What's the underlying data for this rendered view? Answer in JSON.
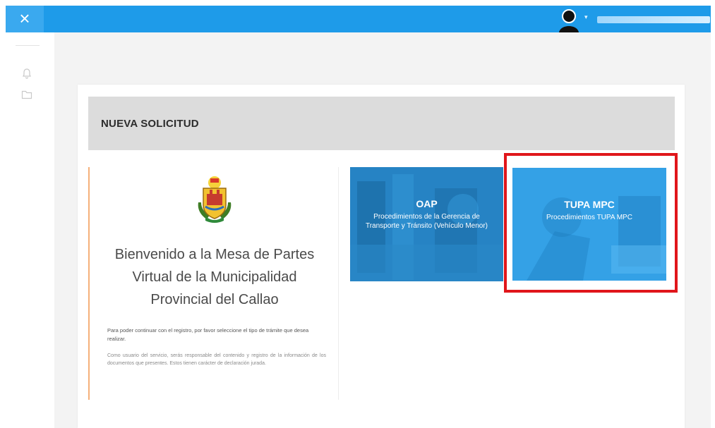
{
  "topbar": {
    "close_icon": "×",
    "avatar_icon": "user-avatar-icon",
    "caret": "▾",
    "accent_color": "#1e9be9"
  },
  "sidebar": {
    "icons": [
      "bell-icon",
      "folder-icon"
    ]
  },
  "card": {
    "title": "NUEVA SOLICITUD"
  },
  "welcome": {
    "title": "Bienvenido a la Mesa de Partes Virtual de la Municipalidad Provincial del Callao",
    "instruction": "Para poder continuar con el registro, por favor seleccione el tipo de trámite que desea realizar.",
    "disclaimer": "Como usuario del servicio, serás responsable del contenido y registro de la información de los documentos que presentes. Estos tienen carácter de declaración jurada.",
    "accent_color": "#f5b07a"
  },
  "tiles": [
    {
      "title": "OAP",
      "subtitle": "Procedimientos de la Gerencia de Transporte y Tránsito (Vehículo Menor)"
    },
    {
      "title": "TUPA MPC",
      "subtitle": "Procedimientos TUPA MPC"
    }
  ],
  "highlight_color": "#e0161b"
}
